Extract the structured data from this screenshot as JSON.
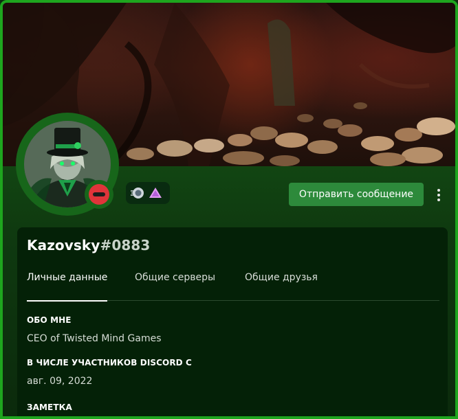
{
  "profile": {
    "username": "Kazovsky",
    "discriminator": "#0883",
    "status": "do-not-disturb",
    "accent_color": "#1ea51e",
    "badges": [
      "hypesquad-icon",
      "nitro-icon"
    ]
  },
  "actions": {
    "send_message_label": "Отправить сообщение",
    "more_icon": "more-vertical-icon"
  },
  "tabs": [
    {
      "label": "Личные данные",
      "active": true
    },
    {
      "label": "Общие серверы",
      "active": false
    },
    {
      "label": "Общие друзья",
      "active": false
    }
  ],
  "sections": {
    "about_title": "Обо мне",
    "about_text": "CEO of Twisted Mind Games",
    "member_since_title": "В числе участников Discord с",
    "member_since_text": "авг. 09, 2022",
    "note_title": "Заметка"
  }
}
